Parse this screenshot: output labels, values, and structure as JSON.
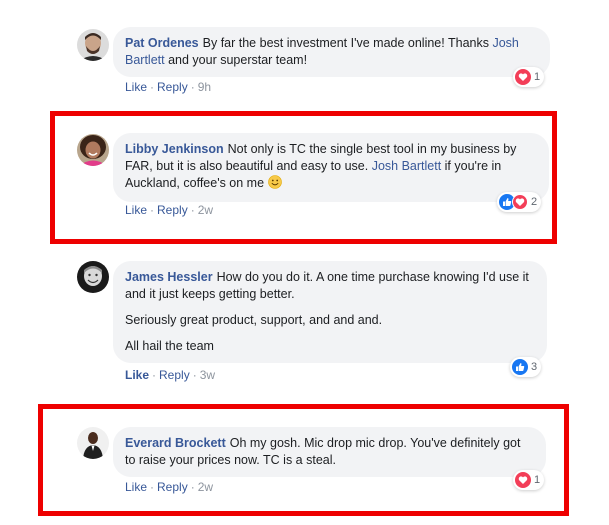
{
  "colors": {
    "link": "#385898",
    "bubble": "#f2f3f5",
    "highlight": "#ee0000",
    "like": "#1877f2",
    "love": "#f33e58"
  },
  "comments": [
    {
      "author": "Pat Ordenes",
      "text_before": "By far the best investment I've made online! Thanks",
      "mention": "Josh Bartlett",
      "text_after": "and your superstar team!",
      "actions": {
        "like": "Like",
        "reply": "Reply",
        "sep": "·",
        "time": "9h"
      },
      "reactions": {
        "icons": [
          "love-icon"
        ],
        "count": "1"
      }
    },
    {
      "author": "Libby Jenkinson",
      "text_before": "Not only is TC the single best tool in my business by FAR, but it is also beautiful and easy to use.",
      "mention": "Josh Bartlett",
      "text_after": "if you're in Auckland, coffee's on me",
      "emoji": "smile-emoji",
      "actions": {
        "like": "Like",
        "reply": "Reply",
        "sep": "·",
        "time": "2w"
      },
      "reactions": {
        "icons": [
          "like-icon",
          "love-icon"
        ],
        "count": "2"
      }
    },
    {
      "author": "James Hessler",
      "text_before": "How do you do it. A one time purchase knowing I'd use it and it just keeps getting better.",
      "paragraph2": "Seriously great product, support, and and and.",
      "paragraph3": "All hail the team",
      "actions": {
        "like": "Like",
        "reply": "Reply",
        "sep": "·",
        "time": "3w"
      },
      "reactions": {
        "icons": [
          "like-icon"
        ],
        "count": "3"
      }
    },
    {
      "author": "Everard Brockett",
      "text_before": "Oh my gosh. Mic drop mic drop. You've definitely got to raise your prices now. TC is a steal.",
      "actions": {
        "like": "Like",
        "reply": "Reply",
        "sep": "·",
        "time": "2w"
      },
      "reactions": {
        "icons": [
          "love-icon"
        ],
        "count": "1"
      }
    }
  ]
}
